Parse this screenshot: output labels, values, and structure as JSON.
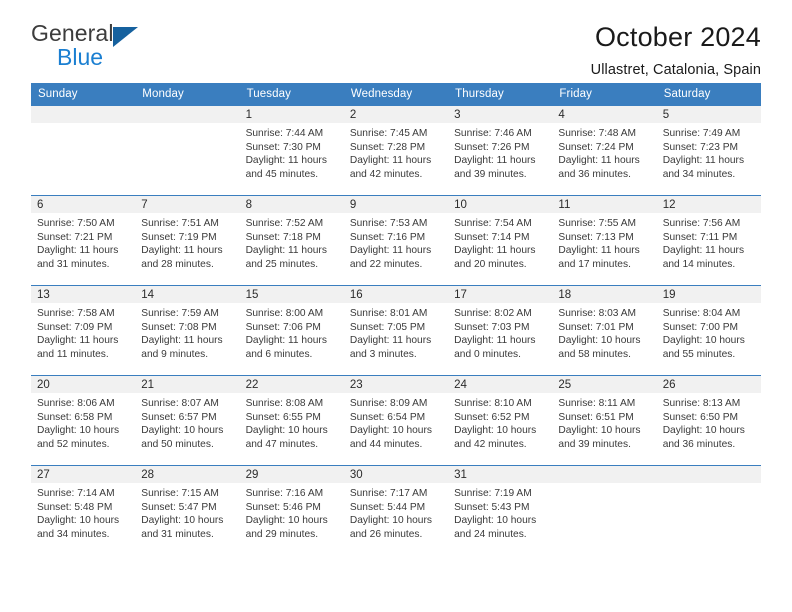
{
  "brand": {
    "name_part1": "General",
    "name_part2": "Blue",
    "logo_icon": "triangle-logo-icon"
  },
  "header": {
    "title": "October 2024",
    "subtitle": "Ullastret, Catalonia, Spain"
  },
  "colors": {
    "header_blue": "#3a7ebf",
    "brand_blue": "#1b7fd1",
    "brand_dark_blue": "#16619e",
    "daynum_band": "#f1f1f1",
    "text": "#2b2b2b"
  },
  "calendar": {
    "weekday_headers": [
      "Sunday",
      "Monday",
      "Tuesday",
      "Wednesday",
      "Thursday",
      "Friday",
      "Saturday"
    ],
    "weeks": [
      [
        {
          "day": "",
          "lines": [
            "",
            "",
            "",
            ""
          ]
        },
        {
          "day": "",
          "lines": [
            "",
            "",
            "",
            ""
          ]
        },
        {
          "day": "1",
          "lines": [
            "Sunrise: 7:44 AM",
            "Sunset: 7:30 PM",
            "Daylight: 11 hours",
            "and 45 minutes."
          ]
        },
        {
          "day": "2",
          "lines": [
            "Sunrise: 7:45 AM",
            "Sunset: 7:28 PM",
            "Daylight: 11 hours",
            "and 42 minutes."
          ]
        },
        {
          "day": "3",
          "lines": [
            "Sunrise: 7:46 AM",
            "Sunset: 7:26 PM",
            "Daylight: 11 hours",
            "and 39 minutes."
          ]
        },
        {
          "day": "4",
          "lines": [
            "Sunrise: 7:48 AM",
            "Sunset: 7:24 PM",
            "Daylight: 11 hours",
            "and 36 minutes."
          ]
        },
        {
          "day": "5",
          "lines": [
            "Sunrise: 7:49 AM",
            "Sunset: 7:23 PM",
            "Daylight: 11 hours",
            "and 34 minutes."
          ]
        }
      ],
      [
        {
          "day": "6",
          "lines": [
            "Sunrise: 7:50 AM",
            "Sunset: 7:21 PM",
            "Daylight: 11 hours",
            "and 31 minutes."
          ]
        },
        {
          "day": "7",
          "lines": [
            "Sunrise: 7:51 AM",
            "Sunset: 7:19 PM",
            "Daylight: 11 hours",
            "and 28 minutes."
          ]
        },
        {
          "day": "8",
          "lines": [
            "Sunrise: 7:52 AM",
            "Sunset: 7:18 PM",
            "Daylight: 11 hours",
            "and 25 minutes."
          ]
        },
        {
          "day": "9",
          "lines": [
            "Sunrise: 7:53 AM",
            "Sunset: 7:16 PM",
            "Daylight: 11 hours",
            "and 22 minutes."
          ]
        },
        {
          "day": "10",
          "lines": [
            "Sunrise: 7:54 AM",
            "Sunset: 7:14 PM",
            "Daylight: 11 hours",
            "and 20 minutes."
          ]
        },
        {
          "day": "11",
          "lines": [
            "Sunrise: 7:55 AM",
            "Sunset: 7:13 PM",
            "Daylight: 11 hours",
            "and 17 minutes."
          ]
        },
        {
          "day": "12",
          "lines": [
            "Sunrise: 7:56 AM",
            "Sunset: 7:11 PM",
            "Daylight: 11 hours",
            "and 14 minutes."
          ]
        }
      ],
      [
        {
          "day": "13",
          "lines": [
            "Sunrise: 7:58 AM",
            "Sunset: 7:09 PM",
            "Daylight: 11 hours",
            "and 11 minutes."
          ]
        },
        {
          "day": "14",
          "lines": [
            "Sunrise: 7:59 AM",
            "Sunset: 7:08 PM",
            "Daylight: 11 hours",
            "and 9 minutes."
          ]
        },
        {
          "day": "15",
          "lines": [
            "Sunrise: 8:00 AM",
            "Sunset: 7:06 PM",
            "Daylight: 11 hours",
            "and 6 minutes."
          ]
        },
        {
          "day": "16",
          "lines": [
            "Sunrise: 8:01 AM",
            "Sunset: 7:05 PM",
            "Daylight: 11 hours",
            "and 3 minutes."
          ]
        },
        {
          "day": "17",
          "lines": [
            "Sunrise: 8:02 AM",
            "Sunset: 7:03 PM",
            "Daylight: 11 hours",
            "and 0 minutes."
          ]
        },
        {
          "day": "18",
          "lines": [
            "Sunrise: 8:03 AM",
            "Sunset: 7:01 PM",
            "Daylight: 10 hours",
            "and 58 minutes."
          ]
        },
        {
          "day": "19",
          "lines": [
            "Sunrise: 8:04 AM",
            "Sunset: 7:00 PM",
            "Daylight: 10 hours",
            "and 55 minutes."
          ]
        }
      ],
      [
        {
          "day": "20",
          "lines": [
            "Sunrise: 8:06 AM",
            "Sunset: 6:58 PM",
            "Daylight: 10 hours",
            "and 52 minutes."
          ]
        },
        {
          "day": "21",
          "lines": [
            "Sunrise: 8:07 AM",
            "Sunset: 6:57 PM",
            "Daylight: 10 hours",
            "and 50 minutes."
          ]
        },
        {
          "day": "22",
          "lines": [
            "Sunrise: 8:08 AM",
            "Sunset: 6:55 PM",
            "Daylight: 10 hours",
            "and 47 minutes."
          ]
        },
        {
          "day": "23",
          "lines": [
            "Sunrise: 8:09 AM",
            "Sunset: 6:54 PM",
            "Daylight: 10 hours",
            "and 44 minutes."
          ]
        },
        {
          "day": "24",
          "lines": [
            "Sunrise: 8:10 AM",
            "Sunset: 6:52 PM",
            "Daylight: 10 hours",
            "and 42 minutes."
          ]
        },
        {
          "day": "25",
          "lines": [
            "Sunrise: 8:11 AM",
            "Sunset: 6:51 PM",
            "Daylight: 10 hours",
            "and 39 minutes."
          ]
        },
        {
          "day": "26",
          "lines": [
            "Sunrise: 8:13 AM",
            "Sunset: 6:50 PM",
            "Daylight: 10 hours",
            "and 36 minutes."
          ]
        }
      ],
      [
        {
          "day": "27",
          "lines": [
            "Sunrise: 7:14 AM",
            "Sunset: 5:48 PM",
            "Daylight: 10 hours",
            "and 34 minutes."
          ]
        },
        {
          "day": "28",
          "lines": [
            "Sunrise: 7:15 AM",
            "Sunset: 5:47 PM",
            "Daylight: 10 hours",
            "and 31 minutes."
          ]
        },
        {
          "day": "29",
          "lines": [
            "Sunrise: 7:16 AM",
            "Sunset: 5:46 PM",
            "Daylight: 10 hours",
            "and 29 minutes."
          ]
        },
        {
          "day": "30",
          "lines": [
            "Sunrise: 7:17 AM",
            "Sunset: 5:44 PM",
            "Daylight: 10 hours",
            "and 26 minutes."
          ]
        },
        {
          "day": "31",
          "lines": [
            "Sunrise: 7:19 AM",
            "Sunset: 5:43 PM",
            "Daylight: 10 hours",
            "and 24 minutes."
          ]
        },
        {
          "day": "",
          "lines": [
            "",
            "",
            "",
            ""
          ]
        },
        {
          "day": "",
          "lines": [
            "",
            "",
            "",
            ""
          ]
        }
      ]
    ]
  }
}
